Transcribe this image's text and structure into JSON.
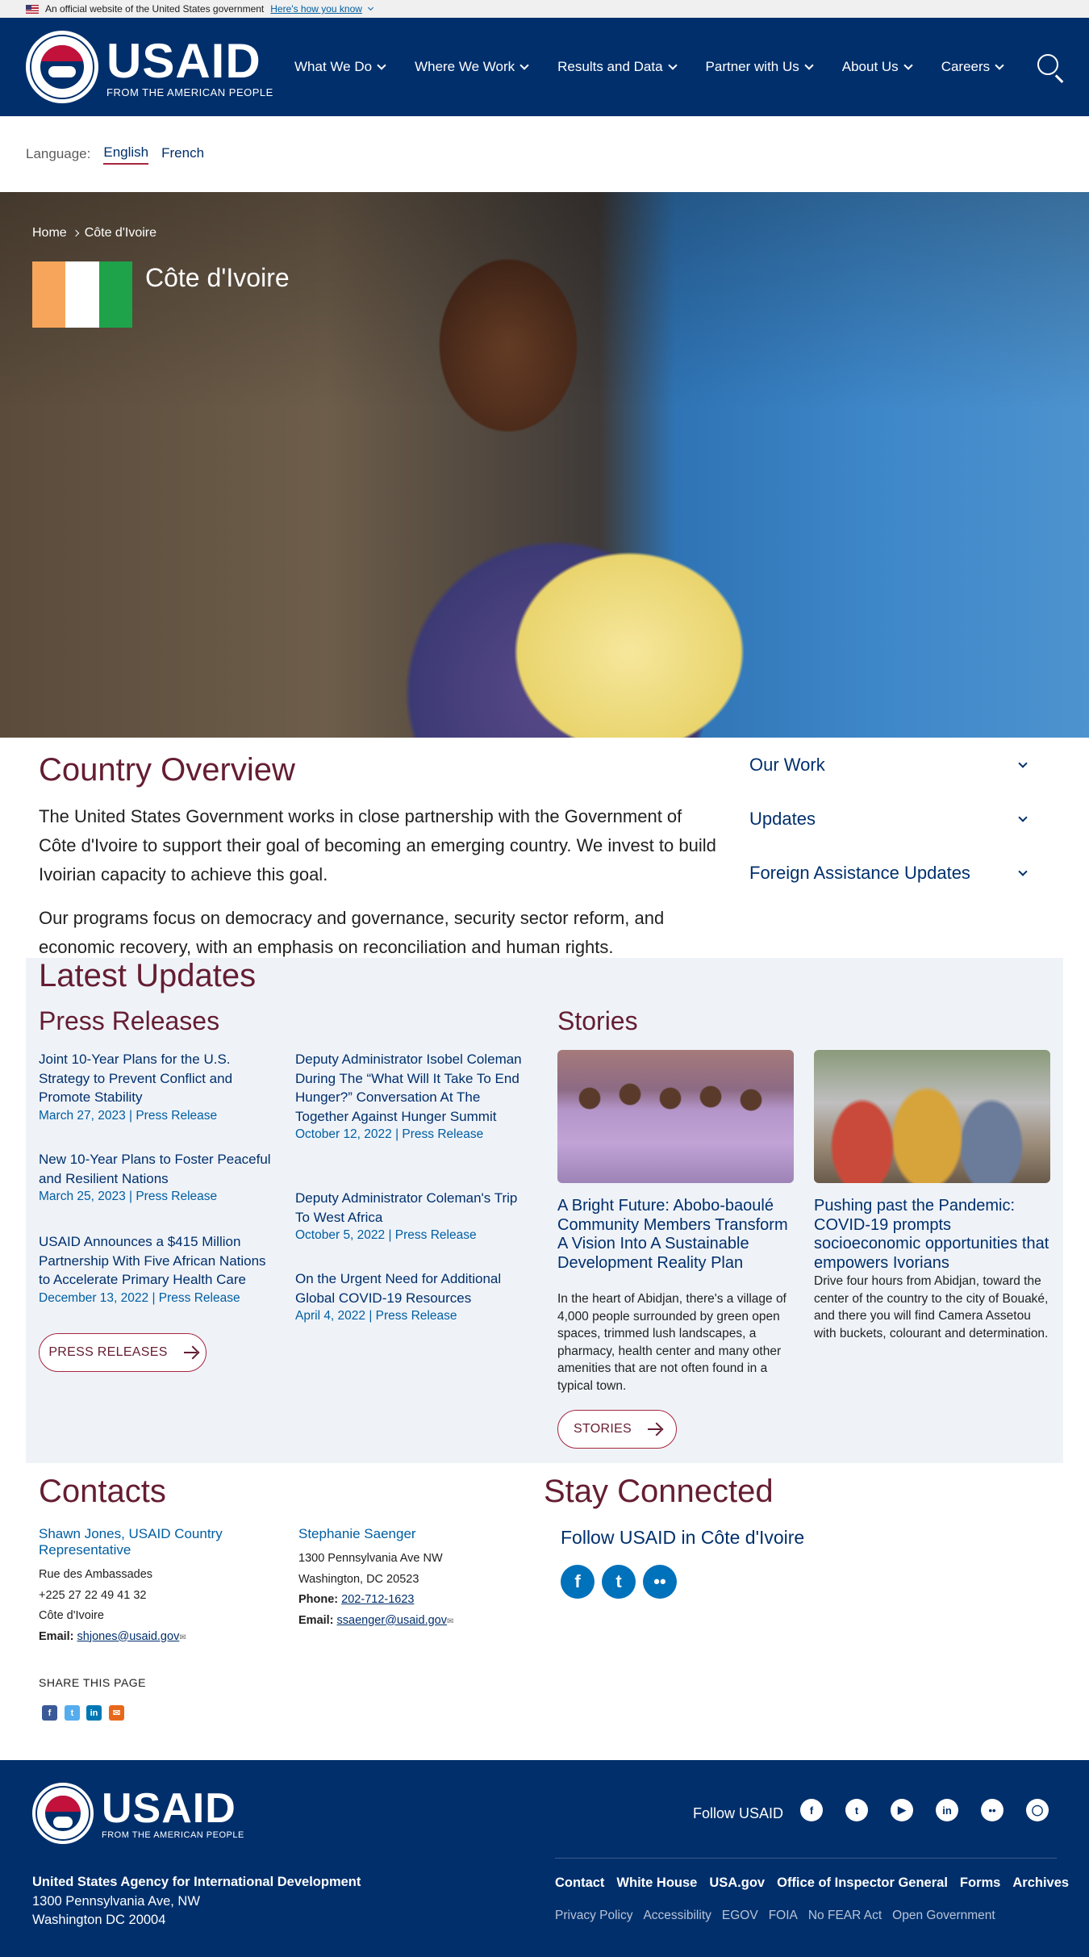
{
  "gov_banner": {
    "text": "An official website of the United States government",
    "link": "Here's how you know"
  },
  "header": {
    "logo_big": "USAID",
    "logo_small": "FROM THE AMERICAN PEOPLE",
    "nav": [
      "What We Do",
      "Where We Work",
      "Results and Data",
      "Partner with Us",
      "About Us",
      "Careers"
    ],
    "search_icon": "search-icon"
  },
  "language": {
    "label": "Language:",
    "options": [
      "English",
      "French"
    ],
    "selected": "English"
  },
  "hero": {
    "breadcrumb": [
      "Home",
      "Côte d'Ivoire"
    ],
    "title": "Côte d'Ivoire",
    "flag_colors": [
      "#f7a55a",
      "#ffffff",
      "#1ea34a"
    ]
  },
  "overview": {
    "title": "Country Overview",
    "p1": "The United States Government works in close partnership with the Government of Côte d'Ivoire to support their goal of becoming an emerging country. We invest to build Ivoirian capacity to achieve this goal.",
    "p2": "Our programs focus on democracy and governance, security sector reform, and economic recovery, with an emphasis on reconciliation and human rights.",
    "accordion": [
      "Our Work",
      "Updates",
      "Foreign Assistance Updates"
    ]
  },
  "updates": {
    "title": "Latest Updates",
    "press_title": "Press Releases",
    "press": [
      {
        "title": "Joint 10-Year Plans for the U.S. Strategy to Prevent Conflict and Promote Stability",
        "meta": "March 27, 2023 | Press Release"
      },
      {
        "title": "New 10-Year Plans to Foster Peaceful and Resilient Nations",
        "meta": "March 25, 2023 | Press Release"
      },
      {
        "title": "USAID Announces a $415 Million Partnership With Five African Nations to Accelerate Primary Health Care",
        "meta": "December 13, 2022 | Press Release"
      },
      {
        "title": "Deputy Administrator Isobel Coleman During The “What Will It Take To End Hunger?” Conversation At The Together Against Hunger Summit",
        "meta": "October 12, 2022 | Press Release"
      },
      {
        "title": "Deputy Administrator Coleman's Trip To West Africa",
        "meta": "October 5, 2022 | Press Release"
      },
      {
        "title": "On the Urgent Need for Additional Global COVID-19 Resources",
        "meta": "April 4, 2022 | Press Release"
      }
    ],
    "press_button": "PRESS RELEASES",
    "stories_title": "Stories",
    "stories": [
      {
        "title": "A Bright Future: Abobo-baoulé Community Members Transform A Vision Into A Sustainable Development Reality Plan",
        "body": "In the heart of Abidjan, there's a village of 4,000 people surrounded by green open spaces, trimmed lush landscapes, a pharmacy, health center and many other amenities that are not often found in a typical town."
      },
      {
        "title": "Pushing past the Pandemic: COVID-19 prompts socioeconomic opportunities that empowers Ivorians",
        "body": "Drive four hours from Abidjan, toward the center of the country to the city of Bouaké, and there you will find Camera Assetou with buckets, colourant and determination."
      }
    ],
    "stories_button": "STORIES"
  },
  "contacts": {
    "title": "Contacts",
    "c1": {
      "name": "Shawn Jones, USAID Country Representative",
      "l1": "Rue des Ambassades",
      "l2": "+225 27 22 49 41 32",
      "l3": "Côte d'Ivoire",
      "email_label": "Email:",
      "email": "shjones@usaid.gov"
    },
    "c2": {
      "name": "Stephanie Saenger",
      "l1": "1300 Pennsylvania Ave NW",
      "l2": "Washington, DC 20523",
      "phone_label": "Phone:",
      "phone": "202-712-1623",
      "email_label": "Email:",
      "email": "ssaenger@usaid.gov"
    },
    "share_label": "SHARE THIS PAGE"
  },
  "stay": {
    "title": "Stay Connected",
    "follow": "Follow USAID in Côte d'Ivoire"
  },
  "footer": {
    "follow": "Follow USAID",
    "org": "United States Agency for International Development",
    "addr1": "1300 Pennsylvania Ave, NW",
    "addr2": "Washington DC 20004",
    "links": [
      "Contact",
      "White House",
      "USA.gov",
      "Office of Inspector General",
      "Forms",
      "Archives"
    ],
    "links2": [
      "Privacy Policy",
      "Accessibility",
      "EGOV",
      "FOIA",
      "No FEAR Act",
      "Open Government"
    ]
  }
}
